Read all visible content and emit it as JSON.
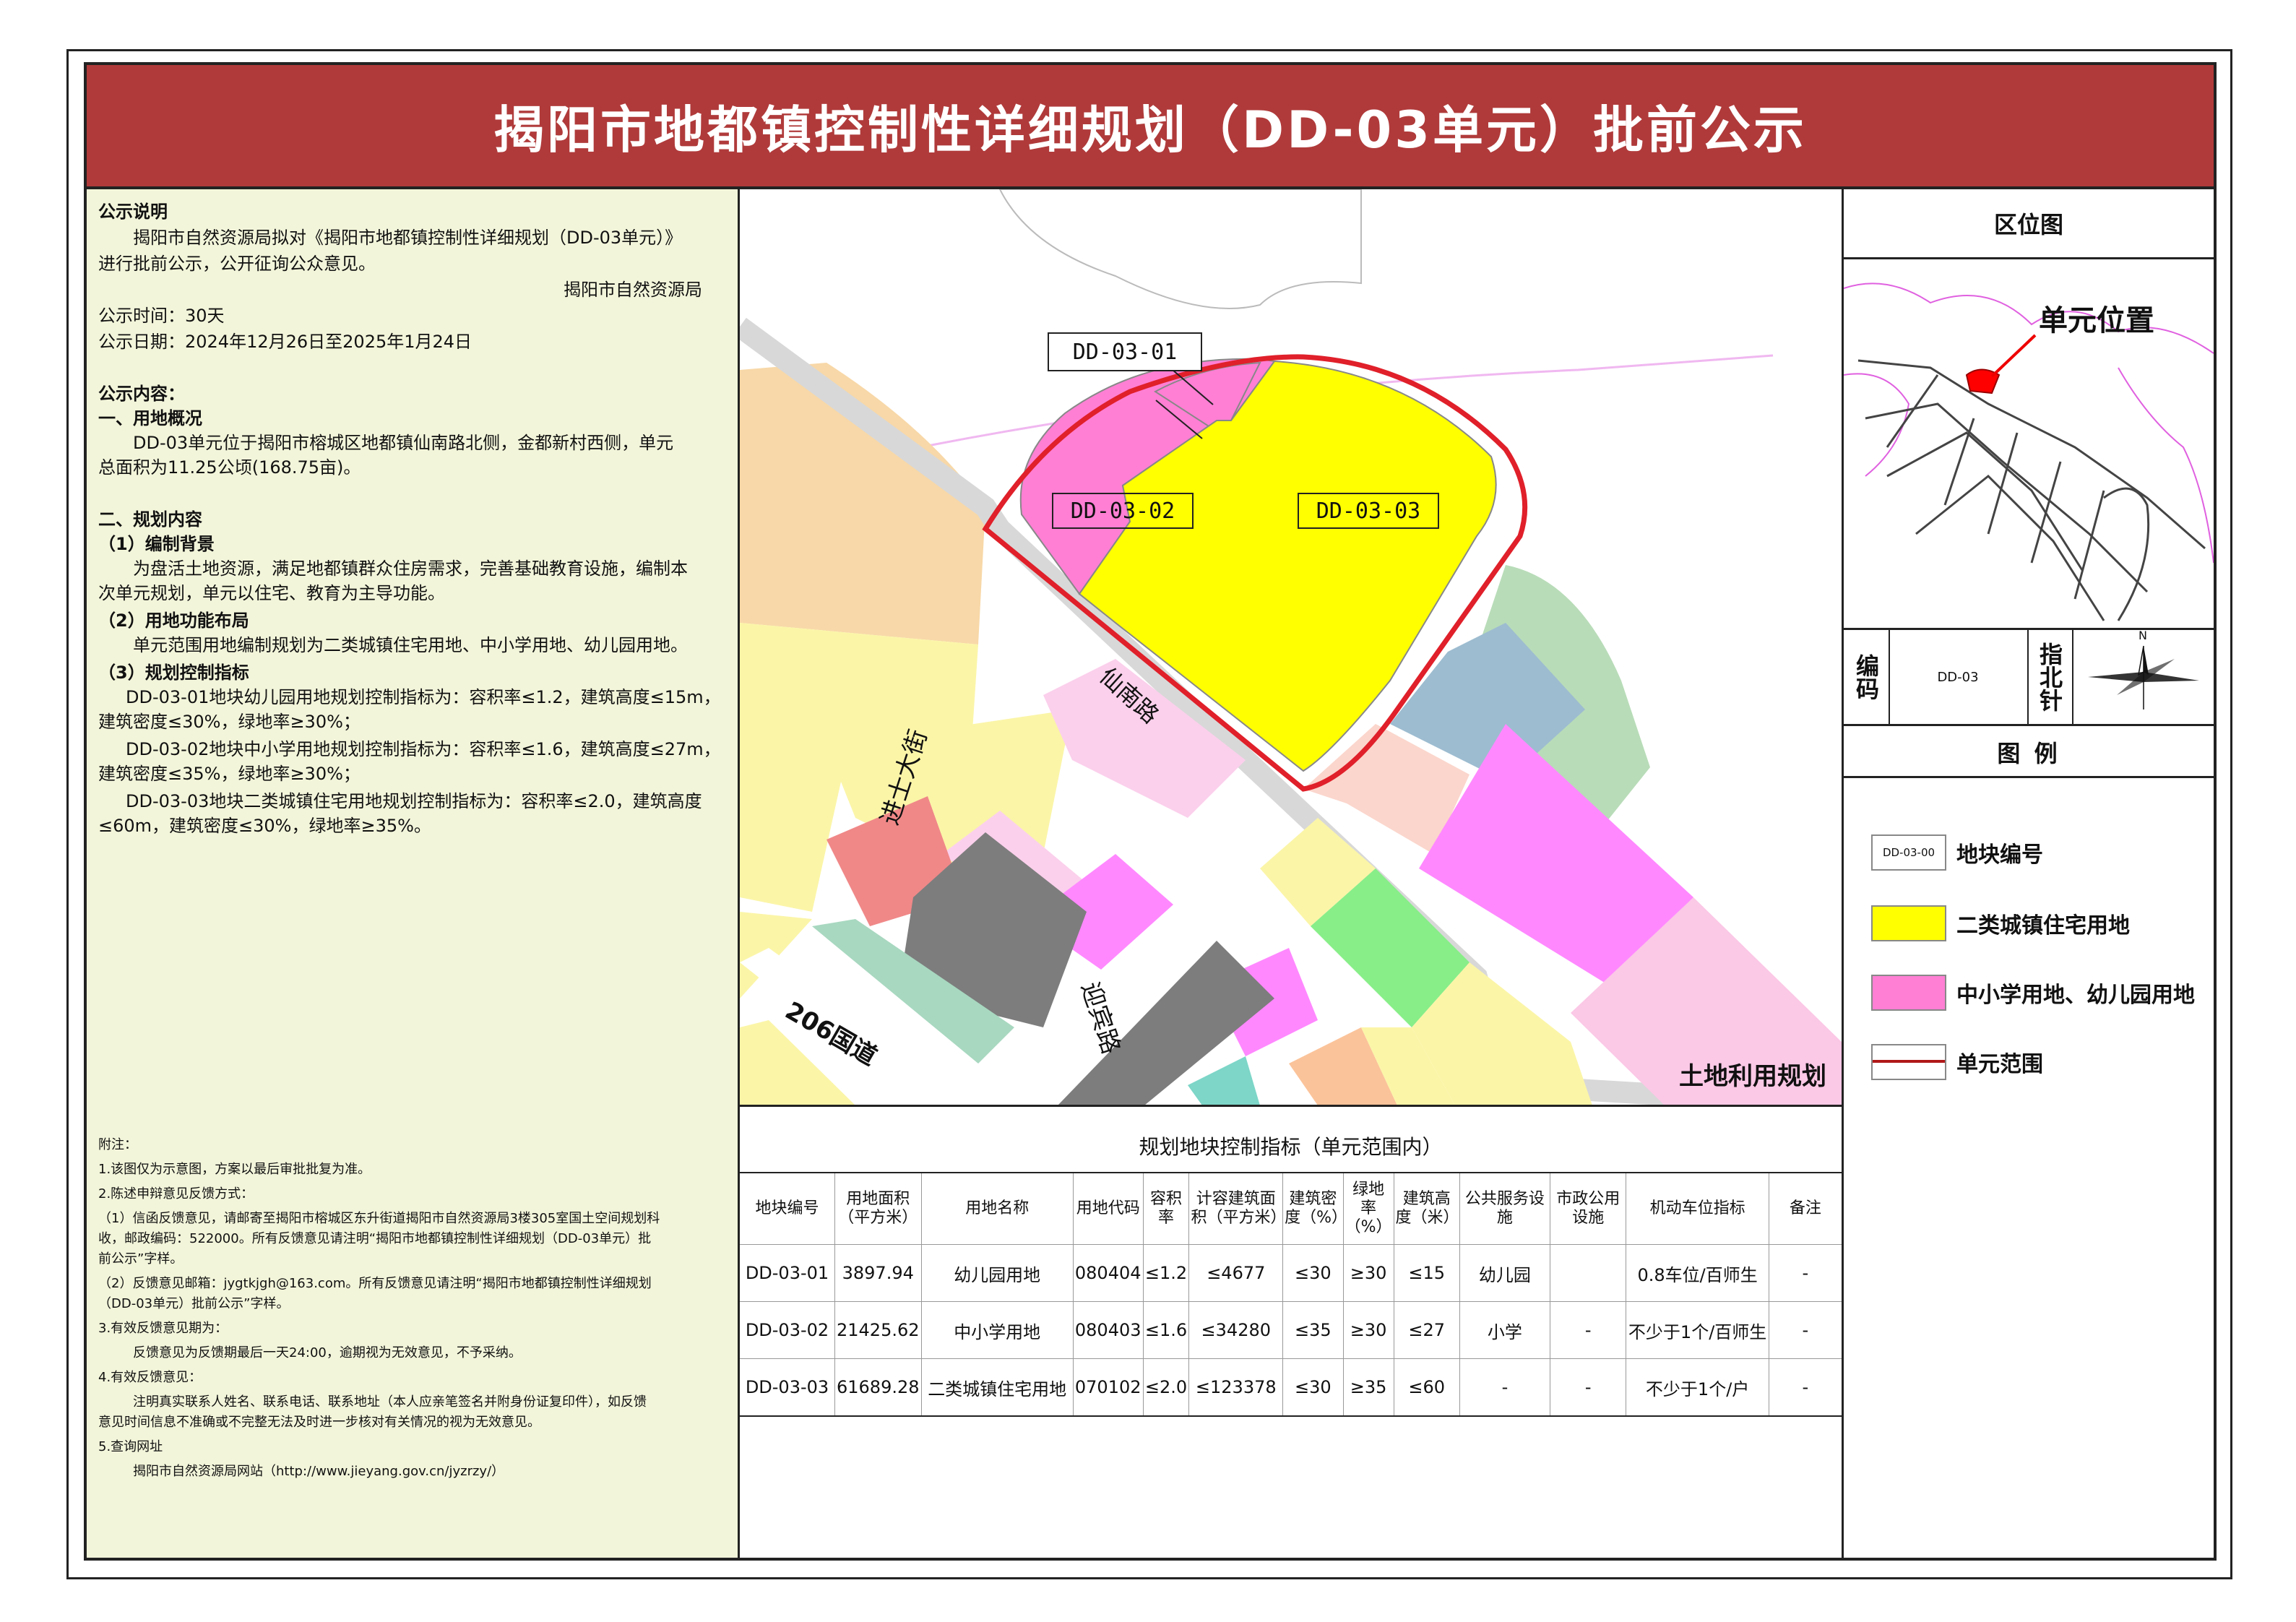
{
  "title": "揭阳市地都镇控制性详细规划（DD-03单元）批前公示",
  "notice": {
    "heading": "公示说明",
    "p1a": "揭阳市自然资源局拟对《揭阳市地都镇控制性详细规划（DD-03单元）》",
    "p1b": "进行批前公示，公开征询公众意见。",
    "org": "揭阳市自然资源局",
    "period": "公示时间：30天",
    "dates": "公示日期：2024年12月26日至2025年1月24日",
    "content_heading": "公示内容：",
    "s1": "一、用地概况",
    "s1a": "DD-03单元位于揭阳市榕城区地都镇仙南路北侧，金都新村西侧，单元",
    "s1b": "总面积为11.25公顷(168.75亩)。",
    "s2": "二、规划内容",
    "s2_1": "（1）编制背景",
    "s2_1a": "为盘活土地资源，满足地都镇群众住房需求，完善基础教育设施，编制本",
    "s2_1b": "次单元规划，单元以住宅、教育为主导功能。",
    "s2_2": "（2）用地功能布局",
    "s2_2a": "单元范围用地编制规划为二类城镇住宅用地、中小学用地、幼儿园用地。",
    "s2_3": "（3）规划控制指标",
    "s2_3a": "DD-03-01地块幼儿园用地规划控制指标为：容积率≤1.2，建筑高度≤15m，",
    "s2_3b": "建筑密度≤30%，绿地率≥30%；",
    "s2_3c": "DD-03-02地块中小学用地规划控制指标为：容积率≤1.6，建筑高度≤27m，",
    "s2_3d": "建筑密度≤35%，绿地率≥30%；",
    "s2_3e": "DD-03-03地块二类城镇住宅用地规划控制指标为：容积率≤2.0，建筑高度",
    "s2_3f": "≤60m，建筑密度≤30%，绿地率≥35%。"
  },
  "notes": {
    "n0": "附注：",
    "n1": "1.该图仅为示意图，方案以最后审批批复为准。",
    "n2": "2.陈述申辩意见反馈方式：",
    "n3": "（1）信函反馈意见，请邮寄至揭阳市榕城区东升街道揭阳市自然资源局3楼305室国土空间规划科",
    "n4": "收，邮政编码：522000。所有反馈意见请注明“揭阳市地都镇控制性详细规划（DD-03单元）批",
    "n5": "前公示”字样。",
    "n6": "（2）反馈意见邮箱：jygtkjgh@163.com。所有反馈意见请注明“揭阳市地都镇控制性详细规划",
    "n7": "（DD-03单元）批前公示”字样。",
    "n8": "3.有效反馈意见期为：",
    "n9": "反馈意见为反馈期最后一天24:00，逾期视为无效意见，不予采纳。",
    "n10": "4.有效反馈意见：",
    "n11": "注明真实联系人姓名、联系电话、联系地址（本人应亲笔签名并附身份证复印件），如反馈",
    "n12": "意见时间信息不准确或不完整无法及时进一步核对有关情况的视为无效意见。",
    "n13": "5.查询网址",
    "n14": "揭阳市自然资源局网站（http://www.jieyang.gov.cn/jyzrzy/）"
  },
  "map": {
    "plot1": "DD-03-01",
    "plot2": "DD-03-02",
    "plot3": "DD-03-03",
    "road_xiannan": "仙南路",
    "road_jinshi": "进士大街",
    "road_yingbin": "迎宾路",
    "road_206": "206国道",
    "caption": "土地利用规划"
  },
  "locator": {
    "heading": "区位图",
    "callout": "单元位置",
    "code_label": "编码",
    "code_value": "DD-03",
    "compass_label": "指北针",
    "north": "N"
  },
  "legend": {
    "heading": "图  例",
    "items": [
      {
        "sample": "DD-03-00",
        "label": "地块编号",
        "fill": "#ffffff"
      },
      {
        "sample": "",
        "label": "二类城镇住宅用地",
        "fill": "#ffff00"
      },
      {
        "sample": "",
        "label": "中小学用地、幼儿园用地",
        "fill": "#ff7fd4"
      },
      {
        "sample": "",
        "label": "单元范围",
        "fill": "#ffffff"
      }
    ]
  },
  "table": {
    "title": "规划地块控制指标（单元范围内）",
    "headers": [
      "地块编号",
      "用地面积（平方米）",
      "用地名称",
      "用地代码",
      "容积率",
      "计容建筑面积（平方米）",
      "建筑密度（%）",
      "绿地率（%）",
      "建筑高度（米）",
      "公共服务设施",
      "市政公用设施",
      "机动车位指标",
      "备注"
    ],
    "rows": [
      [
        "DD-03-01",
        "3897.94",
        "幼儿园用地",
        "080404",
        "≤1.2",
        "≤4677",
        "≤30",
        "≥30",
        "≤15",
        "幼儿园",
        "",
        "0.8车位/百师生",
        "-"
      ],
      [
        "DD-03-02",
        "21425.62",
        "中小学用地",
        "080403",
        "≤1.6",
        "≤34280",
        "≤35",
        "≥30",
        "≤27",
        "小学",
        "-",
        "不少于1个/百师生",
        "-"
      ],
      [
        "DD-03-03",
        "61689.28",
        "二类城镇住宅用地",
        "070102",
        "≤2.0",
        "≤123378",
        "≤30",
        "≥35",
        "≤60",
        "-",
        "-",
        "不少于1个/户",
        "-"
      ]
    ]
  },
  "colors": {
    "title_bg": "#b03a3a",
    "panel_bg": "#f3f5da",
    "residential": "#ffff00",
    "school": "#ff7fd4",
    "boundary": "#e0202a"
  }
}
